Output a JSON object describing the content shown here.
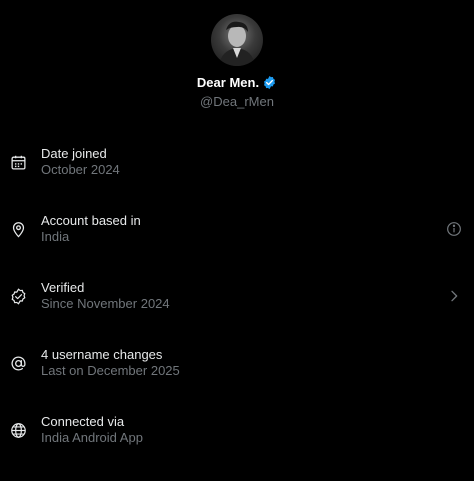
{
  "profile": {
    "display_name": "Dear Men.",
    "handle": "@Dea_rMen",
    "verified": true,
    "badge_color": "#1d9bf0"
  },
  "rows": [
    {
      "title": "Date joined",
      "subtitle": "October 2024",
      "icon": "calendar-icon",
      "action": ""
    },
    {
      "title": "Account based in",
      "subtitle": "India",
      "icon": "location-pin-icon",
      "action": "info-icon"
    },
    {
      "title": "Verified",
      "subtitle": "Since November 2024",
      "icon": "verified-check-icon",
      "action": "chevron-right-icon"
    },
    {
      "title": "4 username changes",
      "subtitle": "Last on December 2025",
      "icon": "at-sign-icon",
      "action": ""
    },
    {
      "title": "Connected via",
      "subtitle": "India Android App",
      "icon": "globe-icon",
      "action": ""
    }
  ],
  "colors": {
    "background": "#000000",
    "primary_text": "#e7e9ea",
    "secondary_text": "#71767b",
    "accent": "#1d9bf0"
  }
}
